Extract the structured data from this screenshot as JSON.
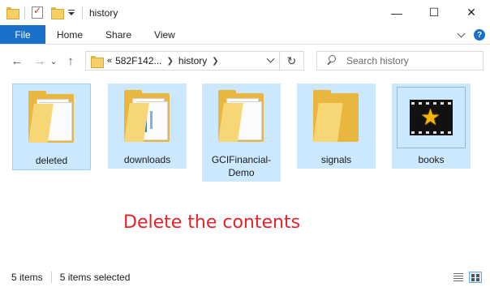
{
  "window": {
    "title": "history",
    "controls": {
      "minimize": "—",
      "maximize": "☐",
      "close": "✕"
    }
  },
  "ribbon": {
    "tabs": [
      "File",
      "Home",
      "Share",
      "View"
    ],
    "help_label": "?"
  },
  "nav": {
    "back": "←",
    "forward": "→",
    "recent": "⌄",
    "up": "↑",
    "address": {
      "overflow": "«",
      "segments": [
        "582F142...",
        "history"
      ]
    },
    "refresh": "↻",
    "search_placeholder": "Search history"
  },
  "items": [
    {
      "label": "deleted",
      "icon": "folder-documents-icon",
      "selected": true
    },
    {
      "label": "downloads",
      "icon": "folder-documents-icon",
      "selected": true
    },
    {
      "label": "GCIFinancial-Demo",
      "icon": "folder-documents-icon",
      "selected": true
    },
    {
      "label": "signals",
      "icon": "folder-empty-icon",
      "selected": true
    },
    {
      "label": "books",
      "icon": "film-star-icon",
      "selected": true
    }
  ],
  "overlay_text": "Delete the contents",
  "status": {
    "item_count": "5 items",
    "selected_count": "5 items selected"
  },
  "colors": {
    "accent": "#1a6fc9",
    "selection": "#cce8ff",
    "folder": "#e9b640",
    "overlay_text": "#e3232a"
  }
}
